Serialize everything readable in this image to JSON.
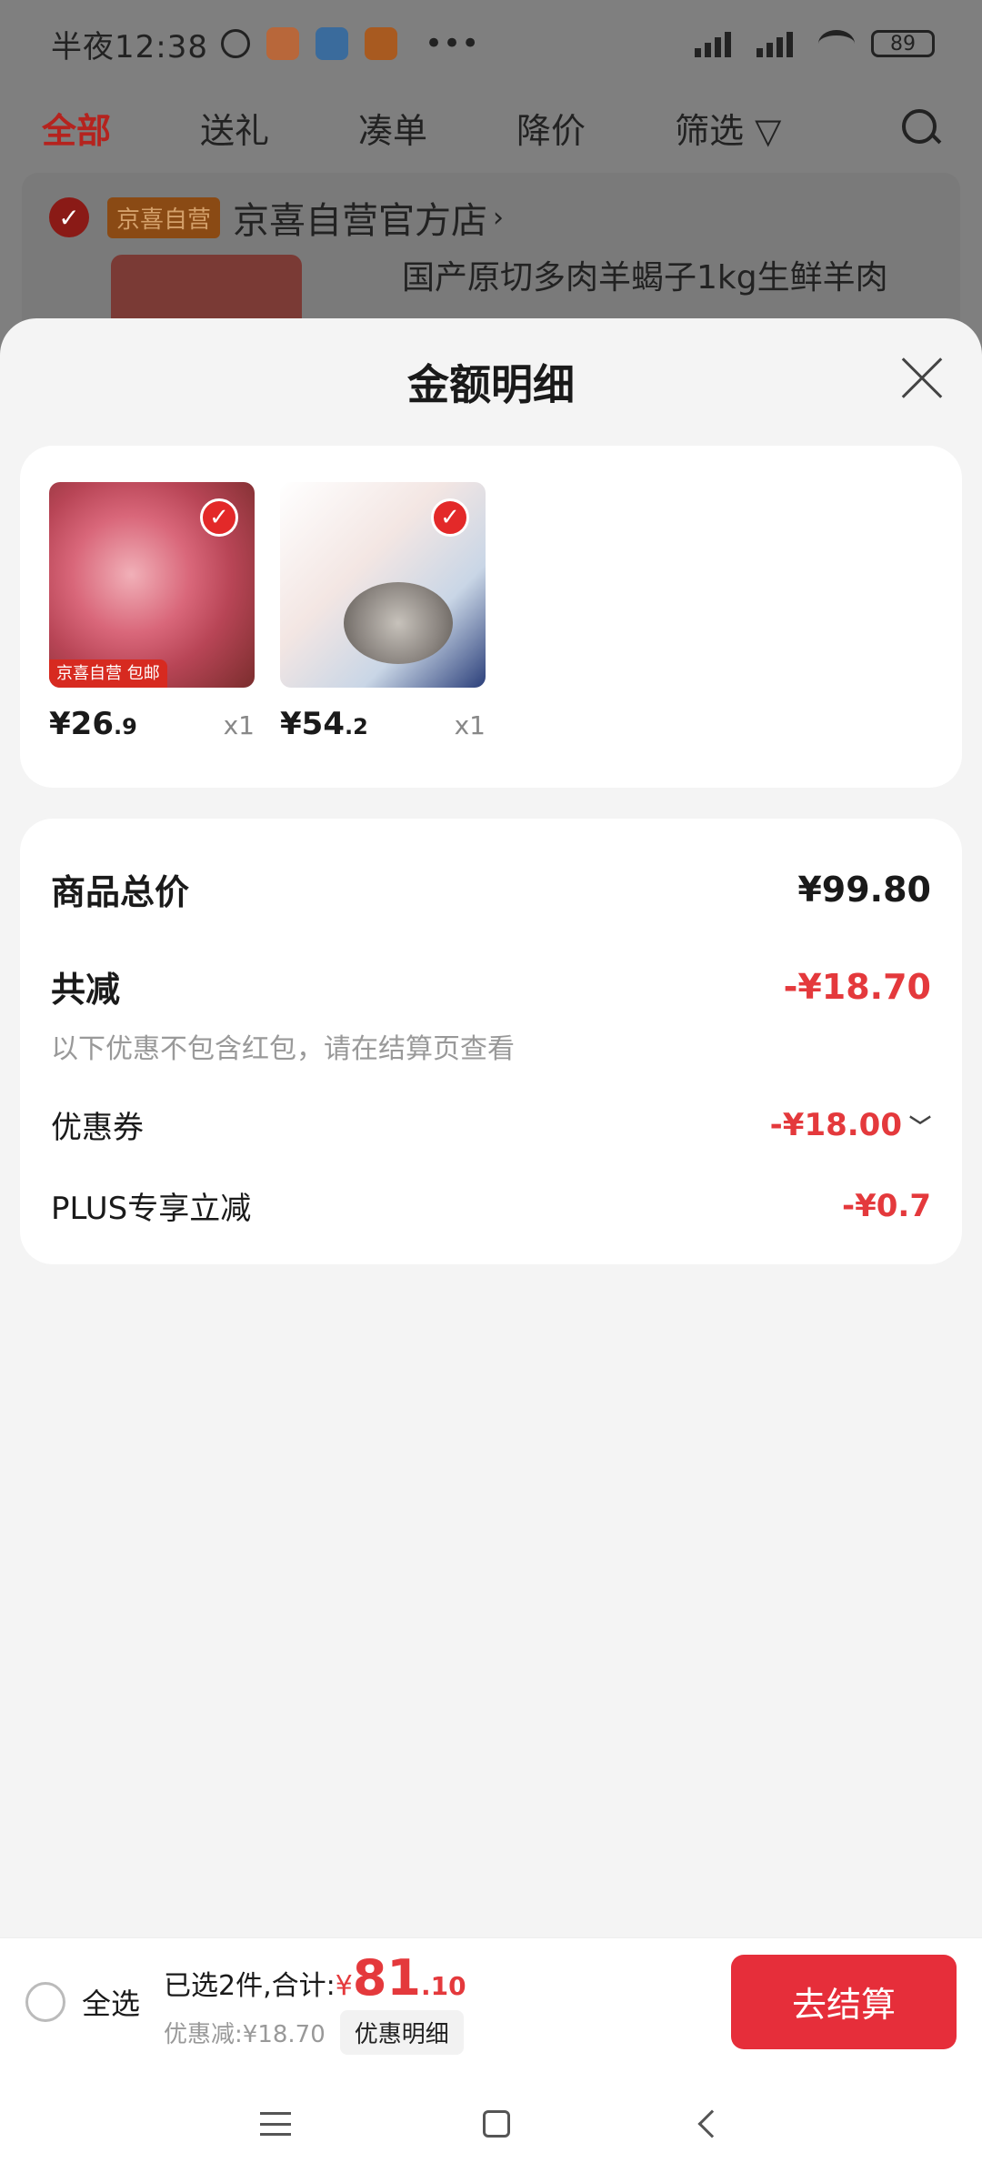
{
  "status_bar": {
    "time": "半夜12:38",
    "battery": "89",
    "colors": {
      "weibo": "#ff6a00",
      "app2": "#1e90ff",
      "mi": "#ff6900"
    }
  },
  "top_tabs": [
    "全部",
    "送礼",
    "凑单",
    "降价",
    "筛选"
  ],
  "store": {
    "tag": "京喜自营",
    "name": "京喜自营官方店",
    "product_title": "国产原切多肉羊蝎子1kg生鲜羊肉"
  },
  "sheet": {
    "title": "金额明细",
    "products": [
      {
        "price_int": "¥26",
        "price_dec": ".9",
        "qty": "x1",
        "tag": "京喜自营 包邮"
      },
      {
        "price_int": "¥54",
        "price_dec": ".2",
        "qty": "x1",
        "tag": ""
      }
    ],
    "summary": {
      "total_label": "商品总价",
      "total_value": "¥99.80",
      "reduce_label": "共减",
      "reduce_value": "-¥18.70",
      "note": "以下优惠不包含红包，请在结算页查看",
      "coupon_label": "优惠券",
      "coupon_value": "-¥18.00",
      "plus_label": "PLUS专享立减",
      "plus_value": "-¥0.7"
    }
  },
  "bottom_bar": {
    "select_all": "全选",
    "selected_label": "已选2件,合计:",
    "yen": "¥",
    "total_int": "81",
    "total_dec": ".10",
    "discount": "优惠减:¥18.70",
    "detail_button": "优惠明细",
    "checkout": "去结算"
  }
}
